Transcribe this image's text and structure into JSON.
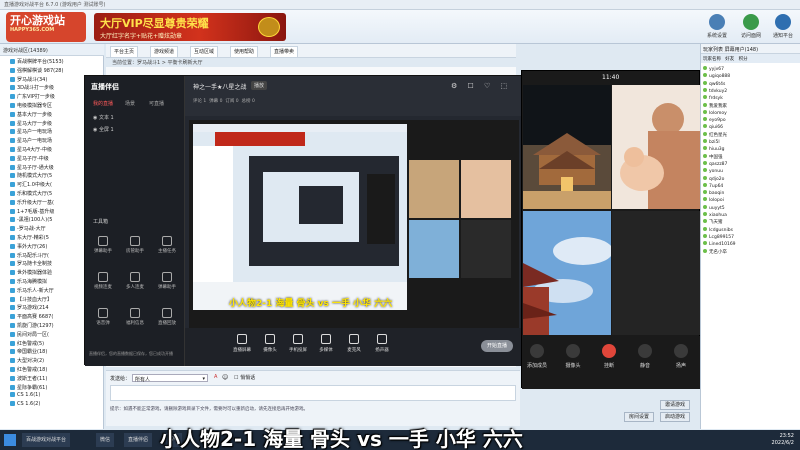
{
  "window": {
    "title": "直播游戏对战平台 6.7.0 (游戏用户 测试账号)"
  },
  "header": {
    "logo_text": "开心游戏站",
    "logo_sub": "HAPPY365.COM",
    "banner_line1": "大厅VIP尽显尊贵荣耀",
    "banner_line2": "大厅红字名字+贴花+赠炫勋章",
    "buttons": [
      "系统设置",
      "访问面网",
      "通知平台"
    ]
  },
  "tree": {
    "header": "游戏对战区(14389)",
    "rows": [
      "百战棋牌平台(5153)",
      "强棋解棋谈 987(28)",
      "罗马战斗(34)",
      "3D战斗打一步级",
      "广东VIP打一步级",
      "电级模拟器专区",
      "基本大厅一步级",
      "星马大厅一步级",
      "星马户一电玩场",
      "星马户一电玩场",
      "星马4大厅-中级",
      "星马子厅-中级",
      "星马子厅-通大级",
      "随机模式大厅(5",
      "可汇1.0中级大(",
      "乐和模式大厅(5",
      "乐升级大厅一基(",
      "1+7毛版-基升级",
      "-黑祖(100人)(5",
      "-罗马战-大厅",
      "东大厅-精彩(5",
      "事外大厅(26)",
      "乐马配乐斗厅(",
      "罗马随卡全制技",
      "世外模拟器体验",
      "乐马海腾模拟",
      "乐马乐人-新大厅",
      "【斗技血大厅】",
      "罗马游戏(214",
      "平面高赛 6687(",
      "凯旋门游(1297)",
      "民间对局一区(",
      "红色警戒(5)",
      "帝国霸业(18)",
      "大型对决(2)",
      "红色警戒(18)",
      "波斯王者(11)",
      "星际争霸(61)",
      "CS 1.6(1)",
      "CS 1.6(2)"
    ]
  },
  "tabs": [
    "平台主页",
    "游戏频道",
    "互动区域",
    "使用帮助",
    "直播带卖"
  ],
  "crumb": "当前位置：罗马战斗1  >  平衡卡刷新大厅",
  "obs": {
    "logo": "直播伴侣",
    "side_tabs": [
      "我的直播",
      "场景",
      "可直播"
    ],
    "scenes": [
      "文本 1",
      "全屏 1"
    ],
    "tools_title": "工具箱",
    "tools": [
      "弹幕助手",
      "房管助手",
      "主播任务",
      "视频连麦",
      "多人连麦",
      "弹幕助手",
      "语音弹",
      "福利信息",
      "直播回放"
    ],
    "room_title": "神之一手★八星之战",
    "room_badge": "播放",
    "stats": [
      "评论 1",
      "弹幕 0",
      "订阅 0",
      "总榜 0"
    ],
    "bottom_buttons": [
      "直播屏幕",
      "摄像头",
      "手机投屏",
      "多媒体",
      "麦克风",
      "扬声器"
    ],
    "start_live": "开始直播",
    "footer_note": "直播伴侣，您的直播数据已保存，您已成功开播"
  },
  "call": {
    "time": "11:40",
    "buttons": [
      "添加成员",
      "摄像头",
      "挂断",
      "静音",
      "扬声"
    ]
  },
  "userlist": {
    "header": "玩家列表  屏幕用户(148)",
    "cols": [
      "玩家名称",
      "好友",
      "积分"
    ],
    "rows": [
      "yyjv67",
      "ugiqo888",
      "qw6t4s",
      "tdvkuy2",
      "frdsyk",
      "我爱我家",
      "lolomoy",
      "eyo9po",
      "qiui66",
      "红色星光",
      "bzi5l",
      "hiuu3g",
      "中国强",
      "qaszz87",
      "yonuu",
      "qdjo2o",
      "7up64",
      "baoqin",
      "lolopoi",
      "uuyyt5",
      "xiaohua",
      "飞天猪",
      "lcdgusnibs",
      "Lcg899157",
      "Lined10169",
      "无名小卒"
    ]
  },
  "chat": {
    "sendto_label": "发送给：",
    "sendto_value": "所有人",
    "checkbox_label": "悄悄话",
    "tip": "提示：如遇不能正常游戏，请删除游戏目录下文件，需要时可以重新启动，请先连接后再开始游戏。",
    "btn_room_settings": "房间设置",
    "btn_invite": "邀请游戏",
    "btn_start_game": "启动游戏"
  },
  "caption": "小人物2-1   海量  骨头 vs  一手  小华  六六",
  "taskbar": {
    "tasks": [
      "百战游戏对战平台",
      "微信",
      "直播伴侣",
      "QQ"
    ],
    "time": "23:52",
    "date": "2022/6/2"
  },
  "colors": {
    "accent": "#d2321c",
    "obs_bg": "#242830",
    "call_bg": "#1a1a1a"
  }
}
